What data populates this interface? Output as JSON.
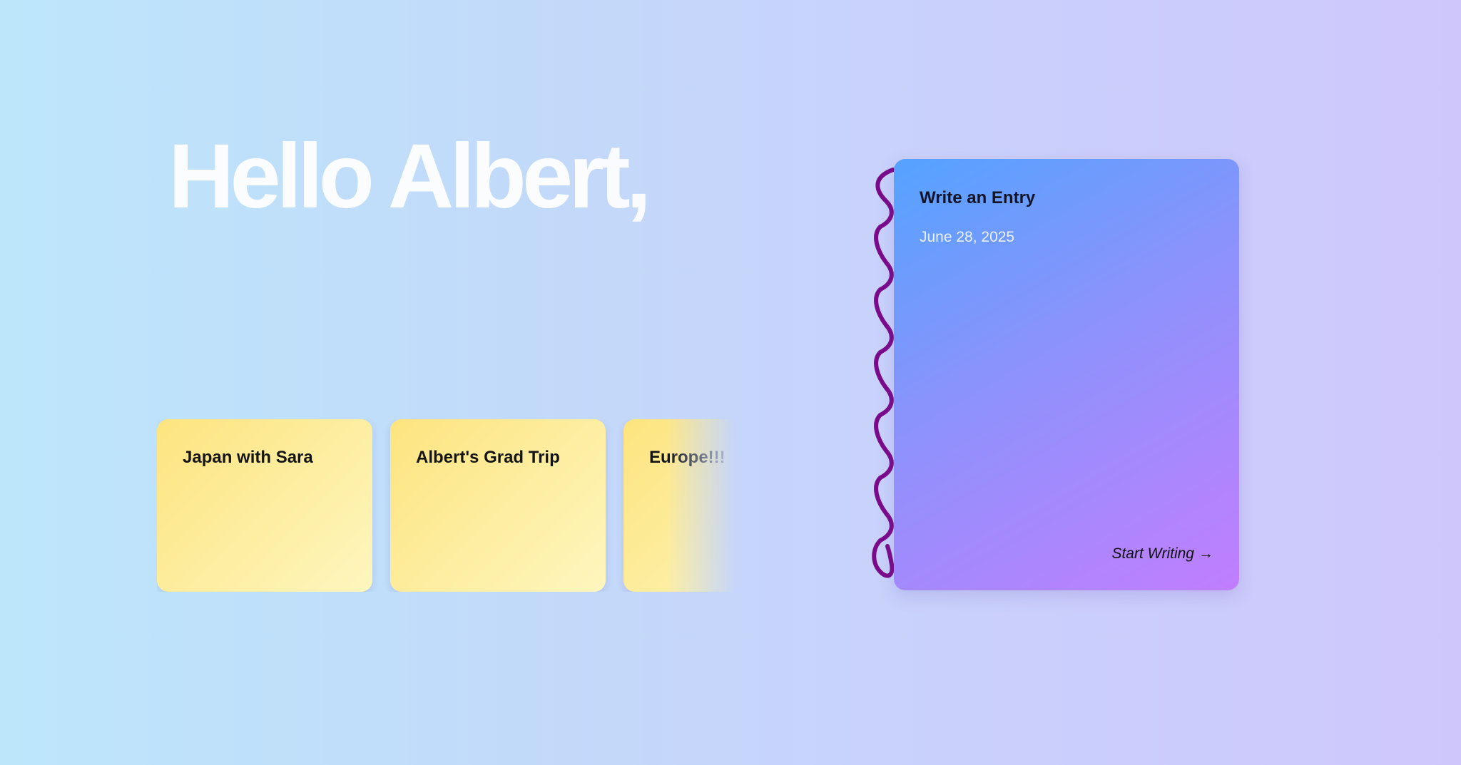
{
  "greeting": "Hello Albert,",
  "journals": [
    {
      "title": "Japan with Sara"
    },
    {
      "title": "Albert's Grad Trip"
    },
    {
      "title": "Europe!!!"
    }
  ],
  "entry_card": {
    "title": "Write an Entry",
    "date": "June 28, 2025",
    "cta_label": "Start Writing",
    "cta_icon": "arrow-right-icon",
    "binding_color": "#7a0a8a"
  },
  "colors": {
    "background_start": "#bde6fb",
    "background_end": "#cfc7fc",
    "journal_card": "#fde89a",
    "entry_gradient_start": "#54a3fe",
    "entry_gradient_end": "#c17efe"
  }
}
